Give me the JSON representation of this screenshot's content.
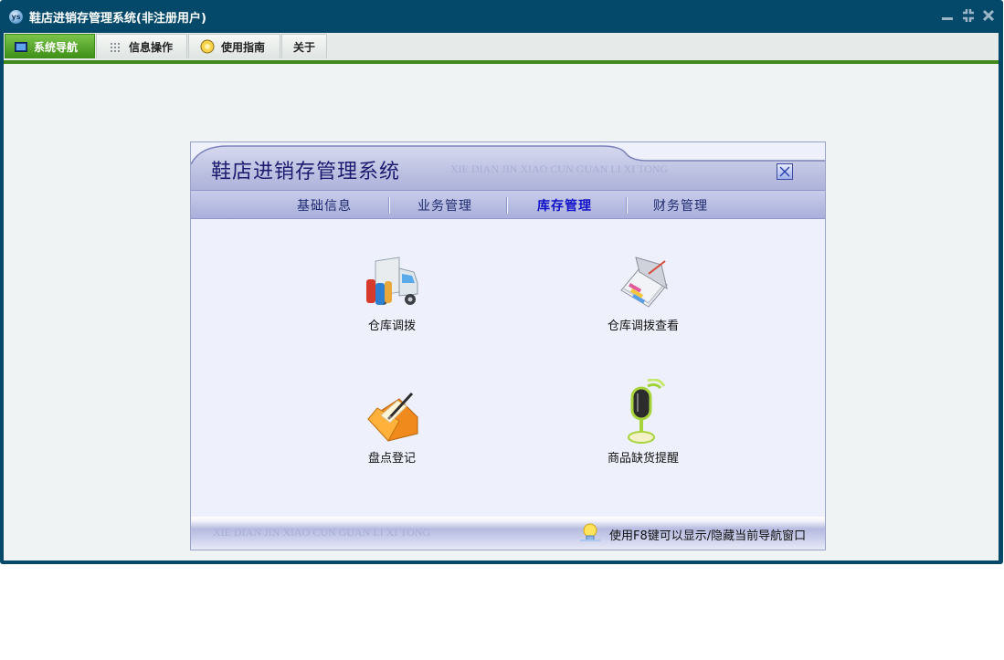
{
  "window": {
    "title": "鞋店进销存管理系统(非注册用户)",
    "logo_text": "ys"
  },
  "menubar": {
    "tabs": [
      {
        "label": "系统导航",
        "icon": "monitor-icon",
        "active": true
      },
      {
        "label": "信息操作",
        "icon": "grid-icon",
        "active": false
      },
      {
        "label": "使用指南",
        "icon": "compass-icon",
        "active": false
      },
      {
        "label": "关于",
        "icon": "",
        "active": false
      }
    ]
  },
  "panel": {
    "title": "鞋店进销存管理系统",
    "subtitle": "XIE DIAN JIN XIAO CUN GUAN LI XI TONG",
    "nav": [
      {
        "label": "基础信息",
        "active": false
      },
      {
        "label": "业务管理",
        "active": false
      },
      {
        "label": "库存管理",
        "active": true
      },
      {
        "label": "财务管理",
        "active": false
      }
    ],
    "tiles": [
      {
        "label": "仓库调拨",
        "icon": "truck-icon"
      },
      {
        "label": "仓库调拨查看",
        "icon": "notebook-icon"
      },
      {
        "label": "盘点登记",
        "icon": "folder-pen-icon"
      },
      {
        "label": "商品缺货提醒",
        "icon": "microphone-icon"
      }
    ],
    "footer": {
      "subtitle": "XIE DIAN JIN XIAO CUN GUAN LI XI TONG",
      "tip": "使用F8键可以显示/隐藏当前导航窗口"
    }
  },
  "colors": {
    "window_frame": "#04496a",
    "active_tab": "#3c8f17",
    "panel_text": "#1b1a6e",
    "nav_active": "#1010c8"
  }
}
